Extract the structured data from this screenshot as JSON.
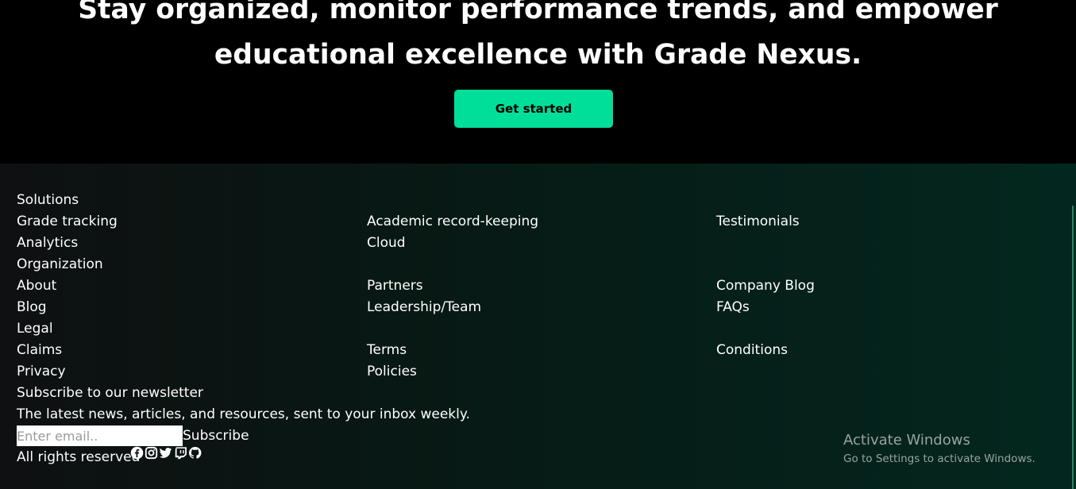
{
  "hero": {
    "title_line1": "Stay organized, monitor performance trends, and empower",
    "title_line2": "educational excellence with Grade Nexus.",
    "cta_label": "Get started",
    "cta_color": "#00df9a"
  },
  "footer": {
    "col1": [
      "Solutions",
      "Grade tracking",
      "Analytics",
      "Organization",
      "About",
      "Blog",
      "Legal",
      "Claims",
      "Privacy"
    ],
    "col2": [
      "Academic record-keeping",
      "Cloud",
      "Partners",
      "Leadership/Team",
      "Terms",
      "Policies"
    ],
    "col3": [
      "Testimonials",
      "Company Blog",
      "FAQs",
      "Conditions"
    ],
    "newsletter": {
      "heading": "Subscribe to our newsletter",
      "description": "The latest news, articles, and resources, sent to your inbox weekly.",
      "email_placeholder": "Enter email..",
      "email_value": "",
      "subscribe_label": "Subscribe"
    },
    "rights": "All rights reserved",
    "social_icons": [
      "facebook-icon",
      "instagram-icon",
      "twitter-icon",
      "twitch-icon",
      "github-icon"
    ]
  },
  "watermark": {
    "title": "Activate Windows",
    "subtitle": "Go to Settings to activate Windows."
  }
}
